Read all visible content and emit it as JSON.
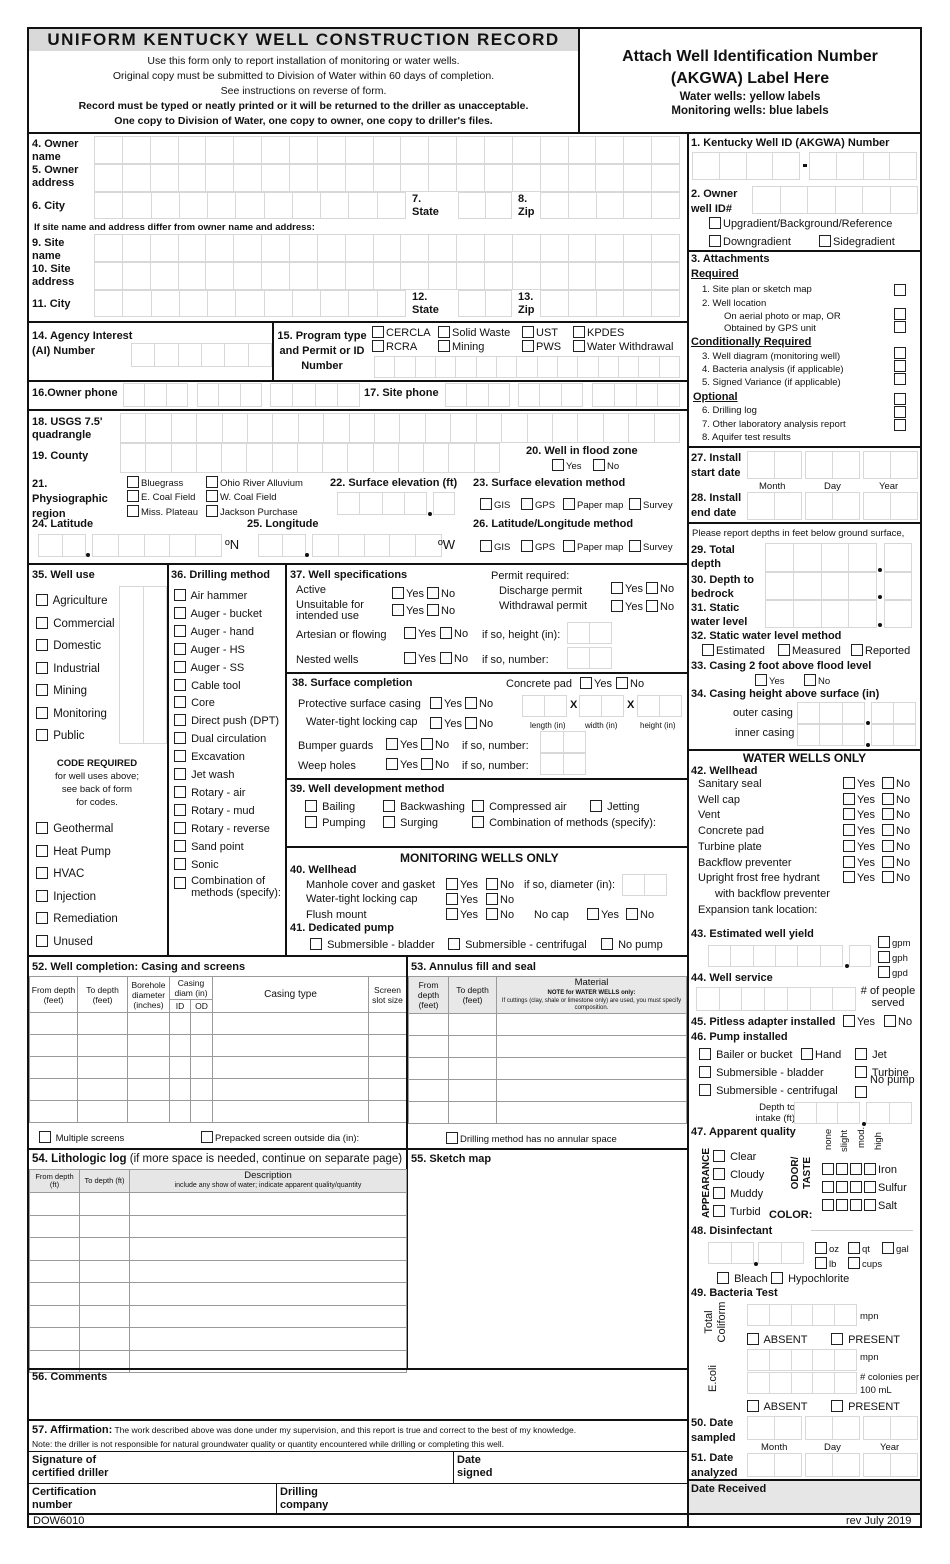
{
  "header": {
    "title": "UNIFORM KENTUCKY WELL CONSTRUCTION RECORD",
    "lines": [
      "Use this form only to report installation of monitoring or water wells.",
      "Original copy must be submitted to Division of Water within 60 days of completion.",
      "See instructions on reverse of form."
    ],
    "bold_lines": [
      "Record must be typed or neatly printed or it will be returned to the driller as unacceptable.",
      "One copy to Division of Water, one copy to owner, one copy to driller's files."
    ]
  },
  "label_box": {
    "title1": "Attach Well Identification Number",
    "title2": "(AKGWA) Label Here",
    "water": "Water wells:  yellow labels",
    "monitoring": "Monitoring wells:  blue labels"
  },
  "owner": {
    "owner_name": "4. Owner name",
    "owner_address": "5. Owner address",
    "city": "6. City",
    "state": "7. State",
    "zip": "8. Zip",
    "note": "If site name and address differ from owner name and address:",
    "site_name": "9. Site name",
    "site_address": "10. Site address",
    "site_city": "11. City",
    "site_state": "12. State",
    "site_zip": "13. Zip"
  },
  "agency": {
    "label": "14. Agency Interest (AI) Number"
  },
  "program": {
    "label": "15. Program type and Permit or ID Number",
    "options": [
      "CERCLA",
      "Solid Waste",
      "UST",
      "KPDES",
      "RCRA",
      "Mining",
      "PWS",
      "Water Withdrawal"
    ]
  },
  "phone": {
    "owner": "16.Owner phone",
    "site": "17. Site phone"
  },
  "location": {
    "usgs": "18. USGS 7.5' quadrangle",
    "county": "19. County",
    "flood": "20. Well in flood zone",
    "yes": "Yes",
    "no": "No",
    "physio": "21. Physiographic region",
    "regions": [
      "Bluegrass",
      "Ohio River Alluvium",
      "E. Coal Field",
      "W. Coal Field",
      "Miss. Plateau",
      "Jackson Purchase"
    ],
    "elev": "22. Surface elevation (ft)",
    "elev_method": "23. Surface elevation method",
    "methods": [
      "GIS",
      "GPS",
      "Paper map",
      "Survey"
    ],
    "lat": "24. Latitude",
    "lon": "25. Longitude",
    "latlon_method": "26. Latitude/Longitude method",
    "n": "ºN",
    "w": "ºW"
  },
  "well_id": {
    "label": "1.  Kentucky Well ID (AKGWA) Number",
    "owner_id": "2. Owner well ID#",
    "gradients": [
      "Upgradient/Background/Reference",
      "Downgradient",
      "Sidegradient"
    ]
  },
  "attachments": {
    "label": "3. Attachments",
    "required": "Required",
    "req_items": [
      "1. Site plan or sketch map",
      "2. Well location",
      "On aerial photo or map, OR",
      "Obtained by GPS unit"
    ],
    "conditional": "Conditionally Required",
    "cond_items": [
      "3. Well diagram (monitoring well)",
      "4. Bacteria analysis (if applicable)",
      "5. Signed Variance (if applicable)"
    ],
    "optional": "Optional",
    "opt_items": [
      "6. Drilling log",
      "7. Other laboratory analysis report",
      "8. Aquifer test results"
    ]
  },
  "install": {
    "start": "27. Install start date",
    "end": "28. Install end date",
    "month": "Month",
    "day": "Day",
    "year": "Year"
  },
  "depths": {
    "note": "Please report depths in feet below ground surface,",
    "total": "29. Total depth",
    "bedrock": "30. Depth to bedrock",
    "static": "31. Static water level",
    "method": "32. Static water level method",
    "methods": [
      "Estimated",
      "Measured",
      "Reported"
    ],
    "casing2ft": "33. Casing 2 foot above flood level",
    "yes": "Yes",
    "no": "No",
    "casing_height": "34. Casing height above surface (in)",
    "outer": "outer casing",
    "inner": "inner casing"
  },
  "well_use": {
    "label": "35. Well use",
    "items": [
      "Agriculture",
      "Commercial",
      "Domestic",
      "Industrial",
      "Mining",
      "Monitoring",
      "Public"
    ],
    "code_req": "CODE REQUIRED",
    "code_note": [
      "for well uses above;",
      "see back of form",
      "for codes."
    ],
    "items2": [
      "Geothermal",
      "Heat Pump",
      "HVAC",
      "Injection",
      "Remediation",
      "Unused"
    ]
  },
  "drilling": {
    "label": "36. Drilling method",
    "items": [
      "Air hammer",
      "Auger - bucket",
      "Auger - hand",
      "Auger - HS",
      "Auger - SS",
      "Cable tool",
      "Core",
      "Direct push (DPT)",
      "Dual circulation",
      "Excavation",
      "Jet wash",
      "Rotary - air",
      "Rotary - mud",
      "Rotary - reverse",
      "Sand point",
      "Sonic",
      "Combination of methods (specify):"
    ]
  },
  "specs": {
    "label": "37. Well specifications",
    "active": "Active",
    "unsuitable": "Unsuitable for intended use",
    "artesian": "Artesian or flowing",
    "nested": "Nested wells",
    "permit": "Permit required:",
    "discharge": "Discharge permit",
    "withdrawal": "Withdrawal permit",
    "height": "if so, height (in):",
    "number": "if so, number:",
    "yes": "Yes",
    "no": "No"
  },
  "surface": {
    "label": "38. Surface completion",
    "concrete": "Concrete pad",
    "protective": "Protective surface casing",
    "locking": "Water-tight locking cap",
    "bumper": "Bumper guards",
    "weep": "Weep holes",
    "number": "if so, number:",
    "length": "length (in)",
    "width": "width (in)",
    "height": "height (in)",
    "x": "X",
    "yes": "Yes",
    "no": "No"
  },
  "development": {
    "label": "39. Well development method",
    "items": [
      "Bailing",
      "Backwashing",
      "Compressed air",
      "Jetting",
      "Pumping",
      "Surging",
      "Combination of methods (specify):"
    ]
  },
  "monitoring": {
    "title": "MONITORING WELLS ONLY",
    "wellhead": "40. Wellhead",
    "manhole": "Manhole cover and gasket",
    "locking": "Water-tight locking cap",
    "flush": "Flush mount",
    "diameter": "if so, diameter (in):",
    "nocap": "No cap",
    "pump": "41. Dedicated pump",
    "pumps": [
      "Submersible - bladder",
      "Submersible - centrifugal",
      "No pump"
    ],
    "yes": "Yes",
    "no": "No"
  },
  "water": {
    "title": "WATER WELLS ONLY",
    "wellhead": "42. Wellhead",
    "items": [
      "Sanitary seal",
      "Well cap",
      "Vent",
      "Concrete pad",
      "Turbine plate",
      "Backflow preventer",
      "Upright frost free hydrant"
    ],
    "hydrant2": "with backflow preventer",
    "expansion": "Expansion tank location:",
    "yield": "43. Estimated well yield",
    "units": [
      "gpm",
      "gph",
      "gpd"
    ],
    "service": "44. Well service",
    "people": "# of people served",
    "pitless": "45. Pitless adapter installed",
    "pump": "46. Pump installed",
    "pumps": [
      "Bailer or bucket",
      "Hand",
      "Jet",
      "Submersible - bladder",
      "Turbine",
      "Submersible - centrifugal",
      "No pump"
    ],
    "intake": "Depth to intake (ft)",
    "quality": "47. Apparent quality",
    "appearance": "APPEARANCE",
    "app_items": [
      "Clear",
      "Cloudy",
      "Muddy",
      "Turbid"
    ],
    "odor": "ODOR/ TASTE",
    "levels": [
      "none",
      "slight",
      "mod.",
      "high"
    ],
    "odors": [
      "Iron",
      "Sulfur",
      "Salt"
    ],
    "color": "COLOR:",
    "disinfectant": "48. Disinfectant",
    "dis_units": [
      "oz",
      "qt",
      "gal",
      "lb",
      "cups"
    ],
    "dis_types": [
      "Bleach",
      "Hypochlorite"
    ],
    "bacteria": "49. Bacteria Test",
    "total_coliform": "Total Coliform",
    "ecoli": "E.coli",
    "mpn": "mpn",
    "colonies": "# colonies per 100 mL",
    "absent": "ABSENT",
    "present": "PRESENT",
    "sampled": "50. Date sampled",
    "analyzed": "51. Date analyzed",
    "month": "Month",
    "day": "Day",
    "year": "Year",
    "yes": "Yes",
    "no": "No"
  },
  "casing": {
    "label": "52. Well completion: Casing and screens",
    "cols": [
      "From depth (feet)",
      "To depth (feet)",
      "Borehole diameter (inches)",
      "Casing diam (in)",
      "Casing type",
      "Screen slot size"
    ],
    "sub": [
      "ID",
      "OD"
    ],
    "multiple": "Multiple screens",
    "prepacked": "Prepacked screen outside dia (in):"
  },
  "annulus": {
    "label": "53. Annulus fill and seal",
    "cols": [
      "From depth (feet)",
      "To depth (feet)",
      "Material"
    ],
    "note_bold": "NOTE for WATER WELLS only:",
    "note": "If cuttings (clay, shale or limestone only) are used, you must specify composition.",
    "no_annular": "Drilling method has no annular space"
  },
  "litho": {
    "label": "54. Lithologic log",
    "note": "(if more space is needed, continue on separate page)",
    "cols": [
      "From depth (ft)",
      "To depth (ft)",
      "Description"
    ],
    "desc_note": "include any show of water; indicate apparent quality/quantity"
  },
  "sketch": {
    "label": "55. Sketch map"
  },
  "comments": {
    "label": "56. Comments"
  },
  "affirm": {
    "label": "57. Affirmation:",
    "text": "The work described above was done under my supervision, and this report is true and correct to the best of my knowledge.",
    "note": "Note:  the driller is not responsible for natural groundwater quality or quantity encountered while drilling or completing this well.",
    "signature": "Signature of certified driller",
    "date": "Date signed",
    "cert": "Certification number",
    "company": "Drilling company"
  },
  "footer": {
    "form": "DOW6010",
    "rev": "rev July 2019",
    "received": "Date Received"
  }
}
